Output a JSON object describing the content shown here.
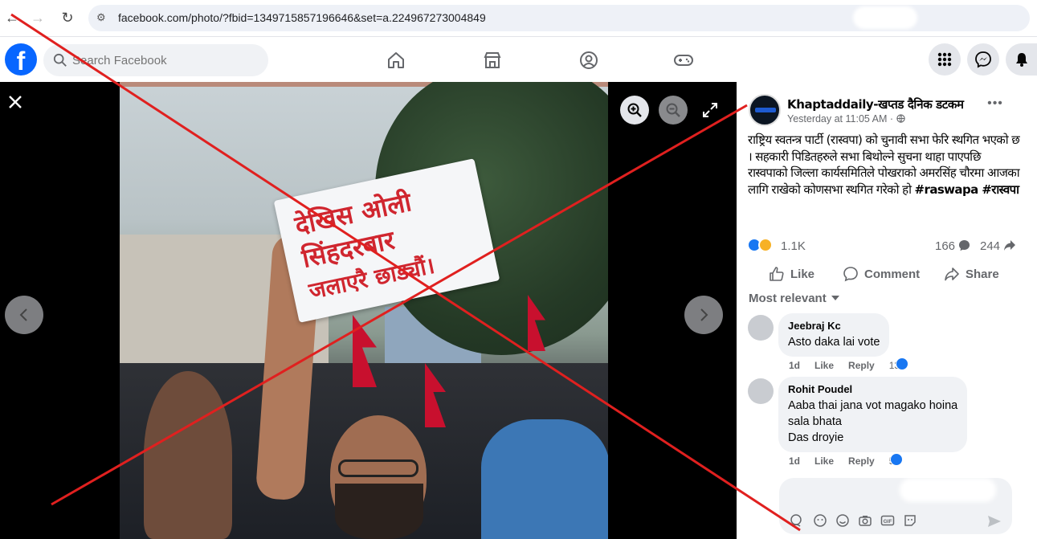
{
  "browser": {
    "url": "facebook.com/photo/?fbid=1349715857196646&set=a.224967273004849"
  },
  "header": {
    "logo": "f",
    "search_placeholder": "Search Facebook"
  },
  "post": {
    "page_name": "Khaptaddaily-खप्तड दैनिक डटकम",
    "timestamp": "Yesterday at 11:05 AM · ",
    "caption": "राष्ट्रिय स्वतन्त्र पार्टी (रास्वपा) को चुनावी सभा फेरि स्थगित भएको छ । सहकारी पिडितहरुले सभा बिथोल्ने सुचना थाहा पाएपछि रास्वपाको जिल्ला कार्यसमितिले पोखराको अमरसिंह चौरमा आजका लागि राखेको कोणसभा स्थगित गरेको हो ",
    "hashtags": "#raswapa #रास्वपा",
    "reactions_count": "1.1K",
    "comments_count": "166",
    "shares_count": "244",
    "actions": {
      "like": "Like",
      "comment": "Comment",
      "share": "Share"
    },
    "sort_label": "Most relevant"
  },
  "photo": {
    "sign_lines": [
      "देखिस ओली",
      "सिंहदरबार",
      "जलाएरै छाड्यौं।"
    ]
  },
  "comments": [
    {
      "name": "Jeebraj Kc",
      "text": [
        "Asto daka lai vote"
      ],
      "age": "1d",
      "like": "Like",
      "reply": "Reply",
      "likes": "13"
    },
    {
      "name": "Rohit Poudel",
      "text": [
        "Aaba thai jana vot magako hoina",
        "sala bhata",
        "Das droyie"
      ],
      "age": "1d",
      "like": "Like",
      "reply": "Reply",
      "likes": "5"
    }
  ],
  "colors": {
    "brand": "#0866ff",
    "overlay_x": "#e0201f",
    "photo_bg": "#000000"
  }
}
